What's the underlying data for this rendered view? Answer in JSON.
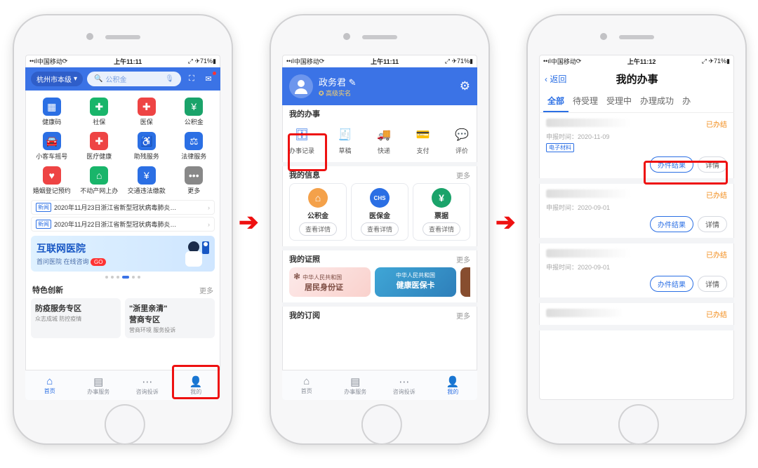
{
  "status": {
    "carrier": "中国移动",
    "time": "上午11:11",
    "battery": "71%",
    "time2": "上午11:12"
  },
  "p1": {
    "location": "杭州市本级",
    "search_placeholder": "公积金",
    "grid": [
      {
        "l": "健康码",
        "c": "#2b6fe4"
      },
      {
        "l": "社保",
        "c": "#19b56a"
      },
      {
        "l": "医保",
        "c": "#e44"
      },
      {
        "l": "公积金",
        "c": "#1aa36a"
      },
      {
        "l": "小客车摇号",
        "c": "#2b6fe4"
      },
      {
        "l": "医疗健康",
        "c": "#e44"
      },
      {
        "l": "助残服务",
        "c": "#2b6fe4"
      },
      {
        "l": "法律服务",
        "c": "#2b6fe4"
      },
      {
        "l": "婚姻登记预约",
        "c": "#e44"
      },
      {
        "l": "不动产网上办",
        "c": "#19b56a"
      },
      {
        "l": "交通违法缴款",
        "c": "#2b6fe4"
      },
      {
        "l": "更多",
        "c": "#888"
      }
    ],
    "news_tag": "新闻",
    "news": [
      "2020年11月23日浙江省新型冠状病毒肺炎…",
      "2020年11月22日浙江省新型冠状病毒肺炎…"
    ],
    "banner": {
      "title": "互联网医院",
      "sub": "首问医院 在线咨询",
      "go": "GO"
    },
    "special_title": "特色创新",
    "more": "更多",
    "cards": [
      {
        "t": "防疫服务专区",
        "s": "众志成城 防控疫情"
      },
      {
        "t": "\"浙里亲清\"\n营商专区",
        "s": "营商环境 服务投诉"
      }
    ],
    "tabs": [
      "首页",
      "办事服务",
      "咨询投诉",
      "我的"
    ]
  },
  "p2": {
    "name": "政务君",
    "badge": "高级实名",
    "sec1": "我的办事",
    "sec2": "我的信息",
    "sec3": "我的证照",
    "sec4": "我的订阅",
    "more": "更多",
    "row5": [
      "办事记录",
      "草稿",
      "快递",
      "支付",
      "评价"
    ],
    "cards3": [
      {
        "t": "公积金",
        "b": "查看详情"
      },
      {
        "t": "医保金",
        "b": "查看详情"
      },
      {
        "t": "票据",
        "b": "查看详情"
      }
    ],
    "id1a": "中华人民共和国",
    "id1b": "居民身份证",
    "id2a": "中华人民共和国",
    "id2b": "健康医保卡",
    "tabs": [
      "首页",
      "办事服务",
      "咨询投诉",
      "我的"
    ]
  },
  "p3": {
    "back": "返回",
    "title": "我的办事",
    "tabs": [
      "全部",
      "待受理",
      "受理中",
      "办理成功",
      "办"
    ],
    "status_done": "已办结",
    "apply_label": "申报时间：",
    "chip": "电子材料",
    "btn_res": "办件结果",
    "btn_det": "详情",
    "records": [
      {
        "date": "2020-11-09",
        "chip": true
      },
      {
        "date": "2020-09-01",
        "chip": false
      },
      {
        "date": "2020-09-01",
        "chip": false
      },
      {
        "date": "",
        "chip": false
      }
    ]
  }
}
